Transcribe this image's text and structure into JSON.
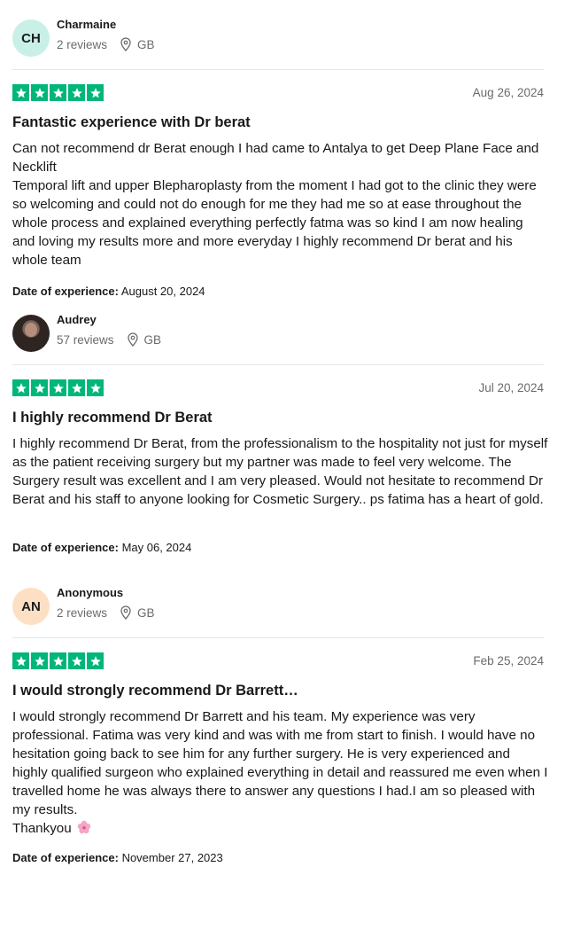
{
  "reviews": [
    {
      "name": "Charmaine",
      "initials": "CH",
      "avatar_color": "#c8f0e6",
      "reviews_count": "2 reviews",
      "country": "GB",
      "rating": 5,
      "date": "Aug 26, 2024",
      "title": "Fantastic experience with Dr berat",
      "body": [
        "Can not recommend dr Berat enough I had came to Antalya to get Deep Plane Face and Necklift",
        "Temporal lift and upper Blepharoplasty from the moment I had got to the clinic they were so welcoming and could not do enough for me they had me so at ease throughout the whole process and explained everything perfectly fatma was so kind I am now healing and loving my results more and more everyday I highly recommend Dr berat and his whole team"
      ],
      "doe_label": "Date of experience:",
      "doe_value": "August 20, 2024"
    },
    {
      "name": "Audrey",
      "initials": "",
      "avatar_color": "#2e2522",
      "reviews_count": "57 reviews",
      "country": "GB",
      "rating": 5,
      "date": "Jul 20, 2024",
      "title": "I highly recommend Dr Berat",
      "body": [
        "I highly recommend Dr Berat, from the professionalism to the hospitality not just for myself as the patient receiving surgery but my partner was made to feel very welcome. The Surgery result was excellent and I am very pleased. Would not hesitate to recommend Dr Berat and his staff to anyone looking for Cosmetic Surgery.. ps fatima has a heart of gold."
      ],
      "doe_label": "Date of experience:",
      "doe_value": "May 06, 2024"
    },
    {
      "name": "Anonymous",
      "initials": "AN",
      "avatar_color": "#fde0c4",
      "reviews_count": "2 reviews",
      "country": "GB",
      "rating": 5,
      "date": "Feb 25, 2024",
      "title": "I would strongly recommend Dr Barrett…",
      "body": [
        "I would strongly recommend Dr Barrett and his team. My experience was very professional. Fatima was very kind and was with me from start to finish. I would have no hesitation going back to see him for any further surgery. He is very experienced and highly qualified surgeon who explained everything in detail and reassured me even when I travelled home he was always there to answer any questions I had.I am so pleased with my results.",
        "Thankyou"
      ],
      "doe_label": "Date of experience:",
      "doe_value": "November 27, 2023"
    }
  ],
  "colors": {
    "star_green": "#00b67a",
    "muted_text": "#6b6b6b",
    "divider": "#e5e5e5"
  },
  "icons": {
    "location": "map-pin-icon",
    "star": "star-icon",
    "flower": "cherry-blossom-emoji"
  }
}
